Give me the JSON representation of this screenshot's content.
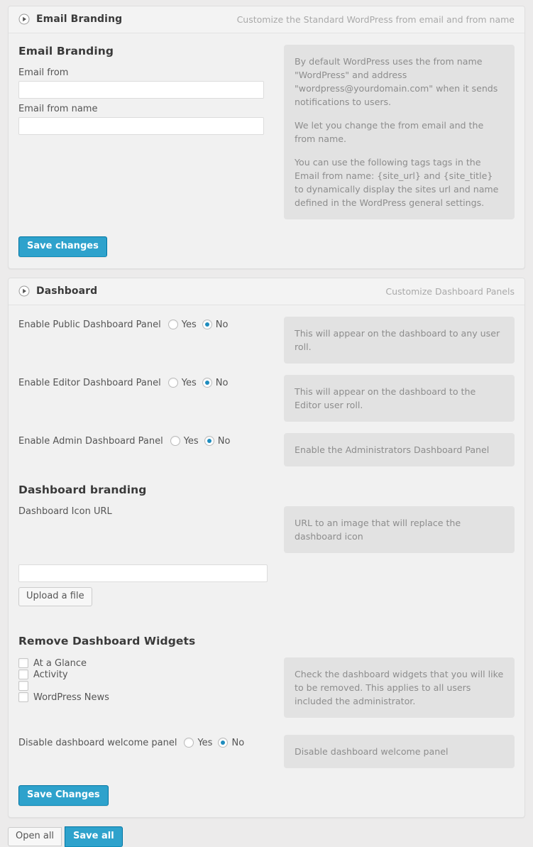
{
  "panels": [
    {
      "id": "email-branding",
      "title": "Email Branding",
      "subtitle": "Customize the Standard WordPress from email and from name",
      "toggle_icon": "circle-play-icon",
      "section_heading": "Email Branding",
      "fields": [
        {
          "label": "Email from",
          "value": "",
          "placeholder": ""
        },
        {
          "label": "Email from name",
          "value": "",
          "placeholder": ""
        }
      ],
      "help_paragraphs": [
        "By default WordPress uses the from name \"WordPress\" and address \"wordpress@yourdomain.com\" when it sends notifications to users.",
        "We let you change the from email and the from name.",
        "You can use the following tags tags in the Email from name: {site_url} and {site_title} to dynamically display the sites url and name defined in the WordPress general settings."
      ],
      "save_label": "Save changes"
    },
    {
      "id": "dashboard",
      "title": "Dashboard",
      "subtitle": "Customize Dashboard Panels",
      "toggle_icon": "circle-play-icon",
      "radio_rows": [
        {
          "label": "Enable Public Dashboard Panel",
          "options": [
            "Yes",
            "No"
          ],
          "selected": "No",
          "help": "This will appear on the dashboard to any user roll."
        },
        {
          "label": "Enable Editor Dashboard Panel",
          "options": [
            "Yes",
            "No"
          ],
          "selected": "No",
          "help": "This will appear on the dashboard to the Editor user roll."
        },
        {
          "label": "Enable Admin Dashboard Panel",
          "options": [
            "Yes",
            "No"
          ],
          "selected": "No",
          "help": "Enable the Administrators Dashboard Panel"
        }
      ],
      "branding": {
        "heading": "Dashboard branding",
        "field_label": "Dashboard Icon URL",
        "field_value": "",
        "upload_label": "Upload a file",
        "help": "URL to an image that will replace the dashboard icon"
      },
      "widgets": {
        "heading": "Remove Dashboard Widgets",
        "items": [
          {
            "label": "At a Glance",
            "checked": false
          },
          {
            "label": "Activity",
            "checked": false
          },
          {
            "label": "",
            "checked": false
          },
          {
            "label": "WordPress News",
            "checked": false
          }
        ],
        "help": "Check the dashboard widgets that you will like to be removed. This applies to all users included the administrator."
      },
      "welcome_panel": {
        "label": "Disable dashboard welcome panel",
        "options": [
          "Yes",
          "No"
        ],
        "selected": "No",
        "help": "Disable dashboard welcome panel"
      },
      "save_label": "Save Changes"
    }
  ],
  "footer": {
    "open_all_label": "Open all",
    "save_all_label": "Save all"
  },
  "colors": {
    "accent": "#2ea2cc",
    "radio_dot": "#1e8cbe",
    "panel_bg": "#f1f1f1",
    "help_bg": "#e2e2e2",
    "page_bg": "#ecebeb"
  }
}
